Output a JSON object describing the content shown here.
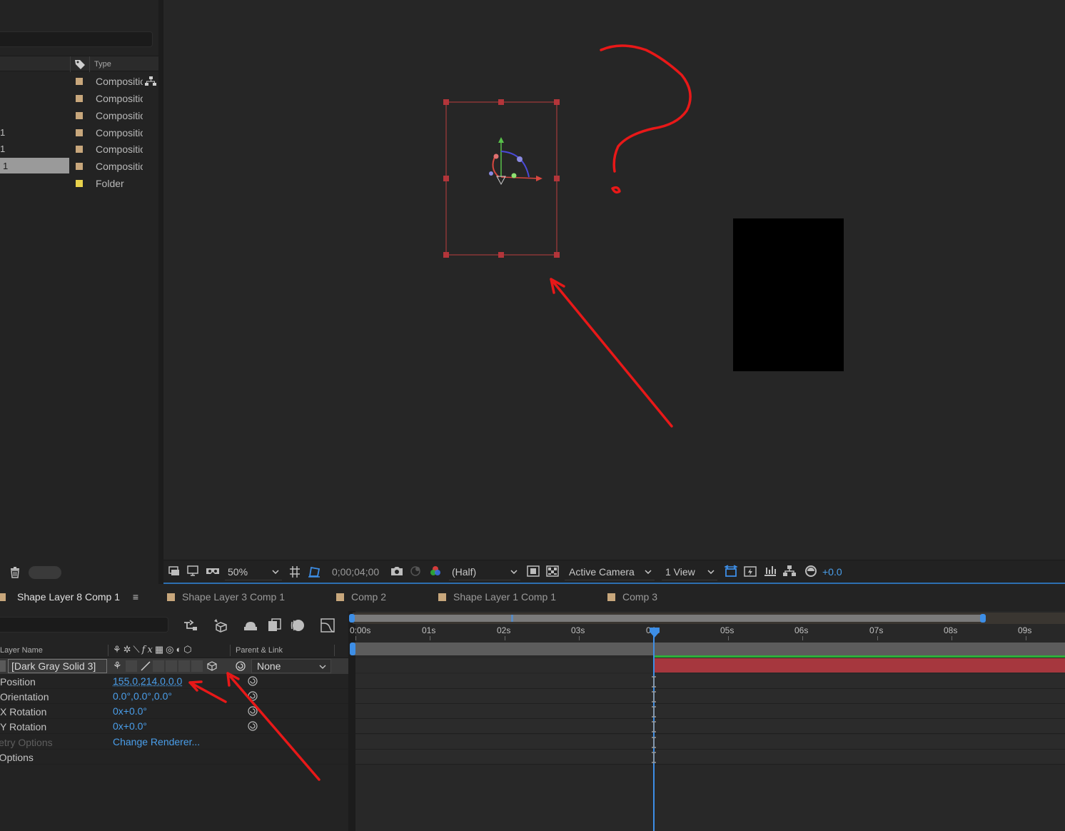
{
  "project": {
    "type_header": "Type",
    "rows": [
      {
        "num": "",
        "type": "Composition",
        "color": "#c8a77c",
        "selected": false
      },
      {
        "num": "",
        "type": "Composition",
        "color": "#c8a77c",
        "selected": false
      },
      {
        "num": "",
        "type": "Composition",
        "color": "#c8a77c",
        "selected": false
      },
      {
        "num": "1",
        "type": "Composition",
        "color": "#c8a77c",
        "selected": false
      },
      {
        "num": "1",
        "type": "Composition",
        "color": "#c8a77c",
        "selected": false
      },
      {
        "num": "1",
        "type": "Composition",
        "color": "#c8a77c",
        "selected": true
      },
      {
        "num": "",
        "type": "Folder",
        "color": "#e8d24c",
        "selected": false
      }
    ]
  },
  "viewer_bar": {
    "zoom": "50%",
    "timecode": "0;00;04;00",
    "resolution": "(Half)",
    "camera": "Active Camera",
    "views": "1 View",
    "exposure": "+0.0"
  },
  "tabs": [
    {
      "label": "Shape Layer 8 Comp 1",
      "active": true,
      "color": "#c8a77c"
    },
    {
      "label": "Shape Layer 3 Comp 1",
      "active": false,
      "color": "#c8a77c"
    },
    {
      "label": "Comp 2",
      "active": false,
      "color": "#c8a77c"
    },
    {
      "label": "Shape Layer 1 Comp 1",
      "active": false,
      "color": "#c8a77c"
    },
    {
      "label": "Comp 3",
      "active": false,
      "color": "#c8a77c"
    }
  ],
  "timeline": {
    "col_layer_name": "Layer Name",
    "col_parent": "Parent & Link",
    "layer": {
      "name": "[Dark Gray Solid 3]",
      "parent": "None"
    },
    "properties": [
      {
        "name": "Position",
        "value": "155.0,214.0,0.0",
        "dim": false
      },
      {
        "name": "Orientation",
        "value": "0.0°,0.0°,0.0°",
        "dim": false
      },
      {
        "name": "X Rotation",
        "value": "0x+0.0°",
        "dim": false
      },
      {
        "name": "Y Rotation",
        "value": "0x+0.0°",
        "dim": false
      },
      {
        "name": "Geometry Options",
        "value": "Change Renderer...",
        "dim": true
      },
      {
        "name": "Material Options",
        "value": "",
        "dim": false
      }
    ],
    "ruler": [
      "0:00s",
      "01s",
      "02s",
      "03s",
      "04s",
      "05s",
      "06s",
      "07s",
      "08s",
      "09s"
    ]
  }
}
